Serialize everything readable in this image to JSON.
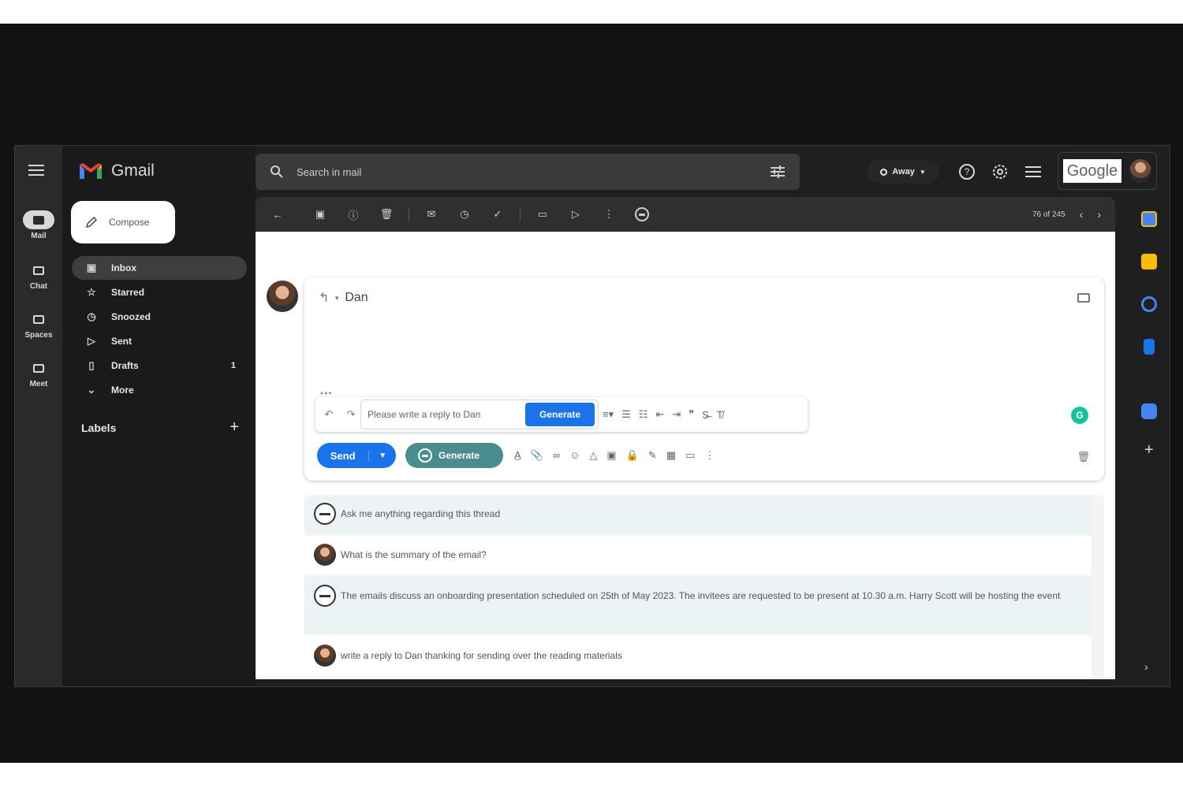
{
  "rail": {
    "items": [
      {
        "label": "Mail"
      },
      {
        "label": "Chat"
      },
      {
        "label": "Spaces"
      },
      {
        "label": "Meet"
      }
    ]
  },
  "app": {
    "name": "Gmail"
  },
  "compose": {
    "label": "Compose"
  },
  "folders": [
    {
      "label": "Inbox",
      "icon": "inbox-icon"
    },
    {
      "label": "Starred",
      "icon": "star-icon"
    },
    {
      "label": "Snoozed",
      "icon": "clock-icon"
    },
    {
      "label": "Sent",
      "icon": "send-icon"
    },
    {
      "label": "Drafts",
      "icon": "file-icon",
      "count": "1"
    },
    {
      "label": "More",
      "icon": "chevron-down-icon"
    }
  ],
  "labels": {
    "title": "Labels"
  },
  "search": {
    "placeholder": "Search in mail"
  },
  "status": {
    "label": "Away"
  },
  "google": {
    "wordmark": "Google"
  },
  "pager": {
    "text": "76 of 245"
  },
  "reply": {
    "recipient": "Dan"
  },
  "assistant_prompt": {
    "text": "Please write a reply to Dan",
    "button": "Generate"
  },
  "send_row": {
    "send": "Send",
    "generate": "Generate"
  },
  "grammarly": {
    "glyph": "G"
  },
  "thread_assistant": {
    "messages": [
      {
        "role": "ai",
        "text": "Ask me anything regarding this thread"
      },
      {
        "role": "user",
        "text": "What is the summary of the email?"
      },
      {
        "role": "ai",
        "text": "The emails discuss an onboarding presentation scheduled on 25th of May 2023. The invitees are requested to be present at 10.30 a.m. Harry Scott will be hosting the event"
      },
      {
        "role": "user",
        "text": "write a reply to Dan thanking for sending over the reading materials"
      }
    ]
  },
  "colors": {
    "accent_blue": "#1a73e8",
    "generate_teal": "#4b8d8f",
    "dark_bg": "#1f1f1f",
    "grammarly_green": "#15c39a"
  }
}
